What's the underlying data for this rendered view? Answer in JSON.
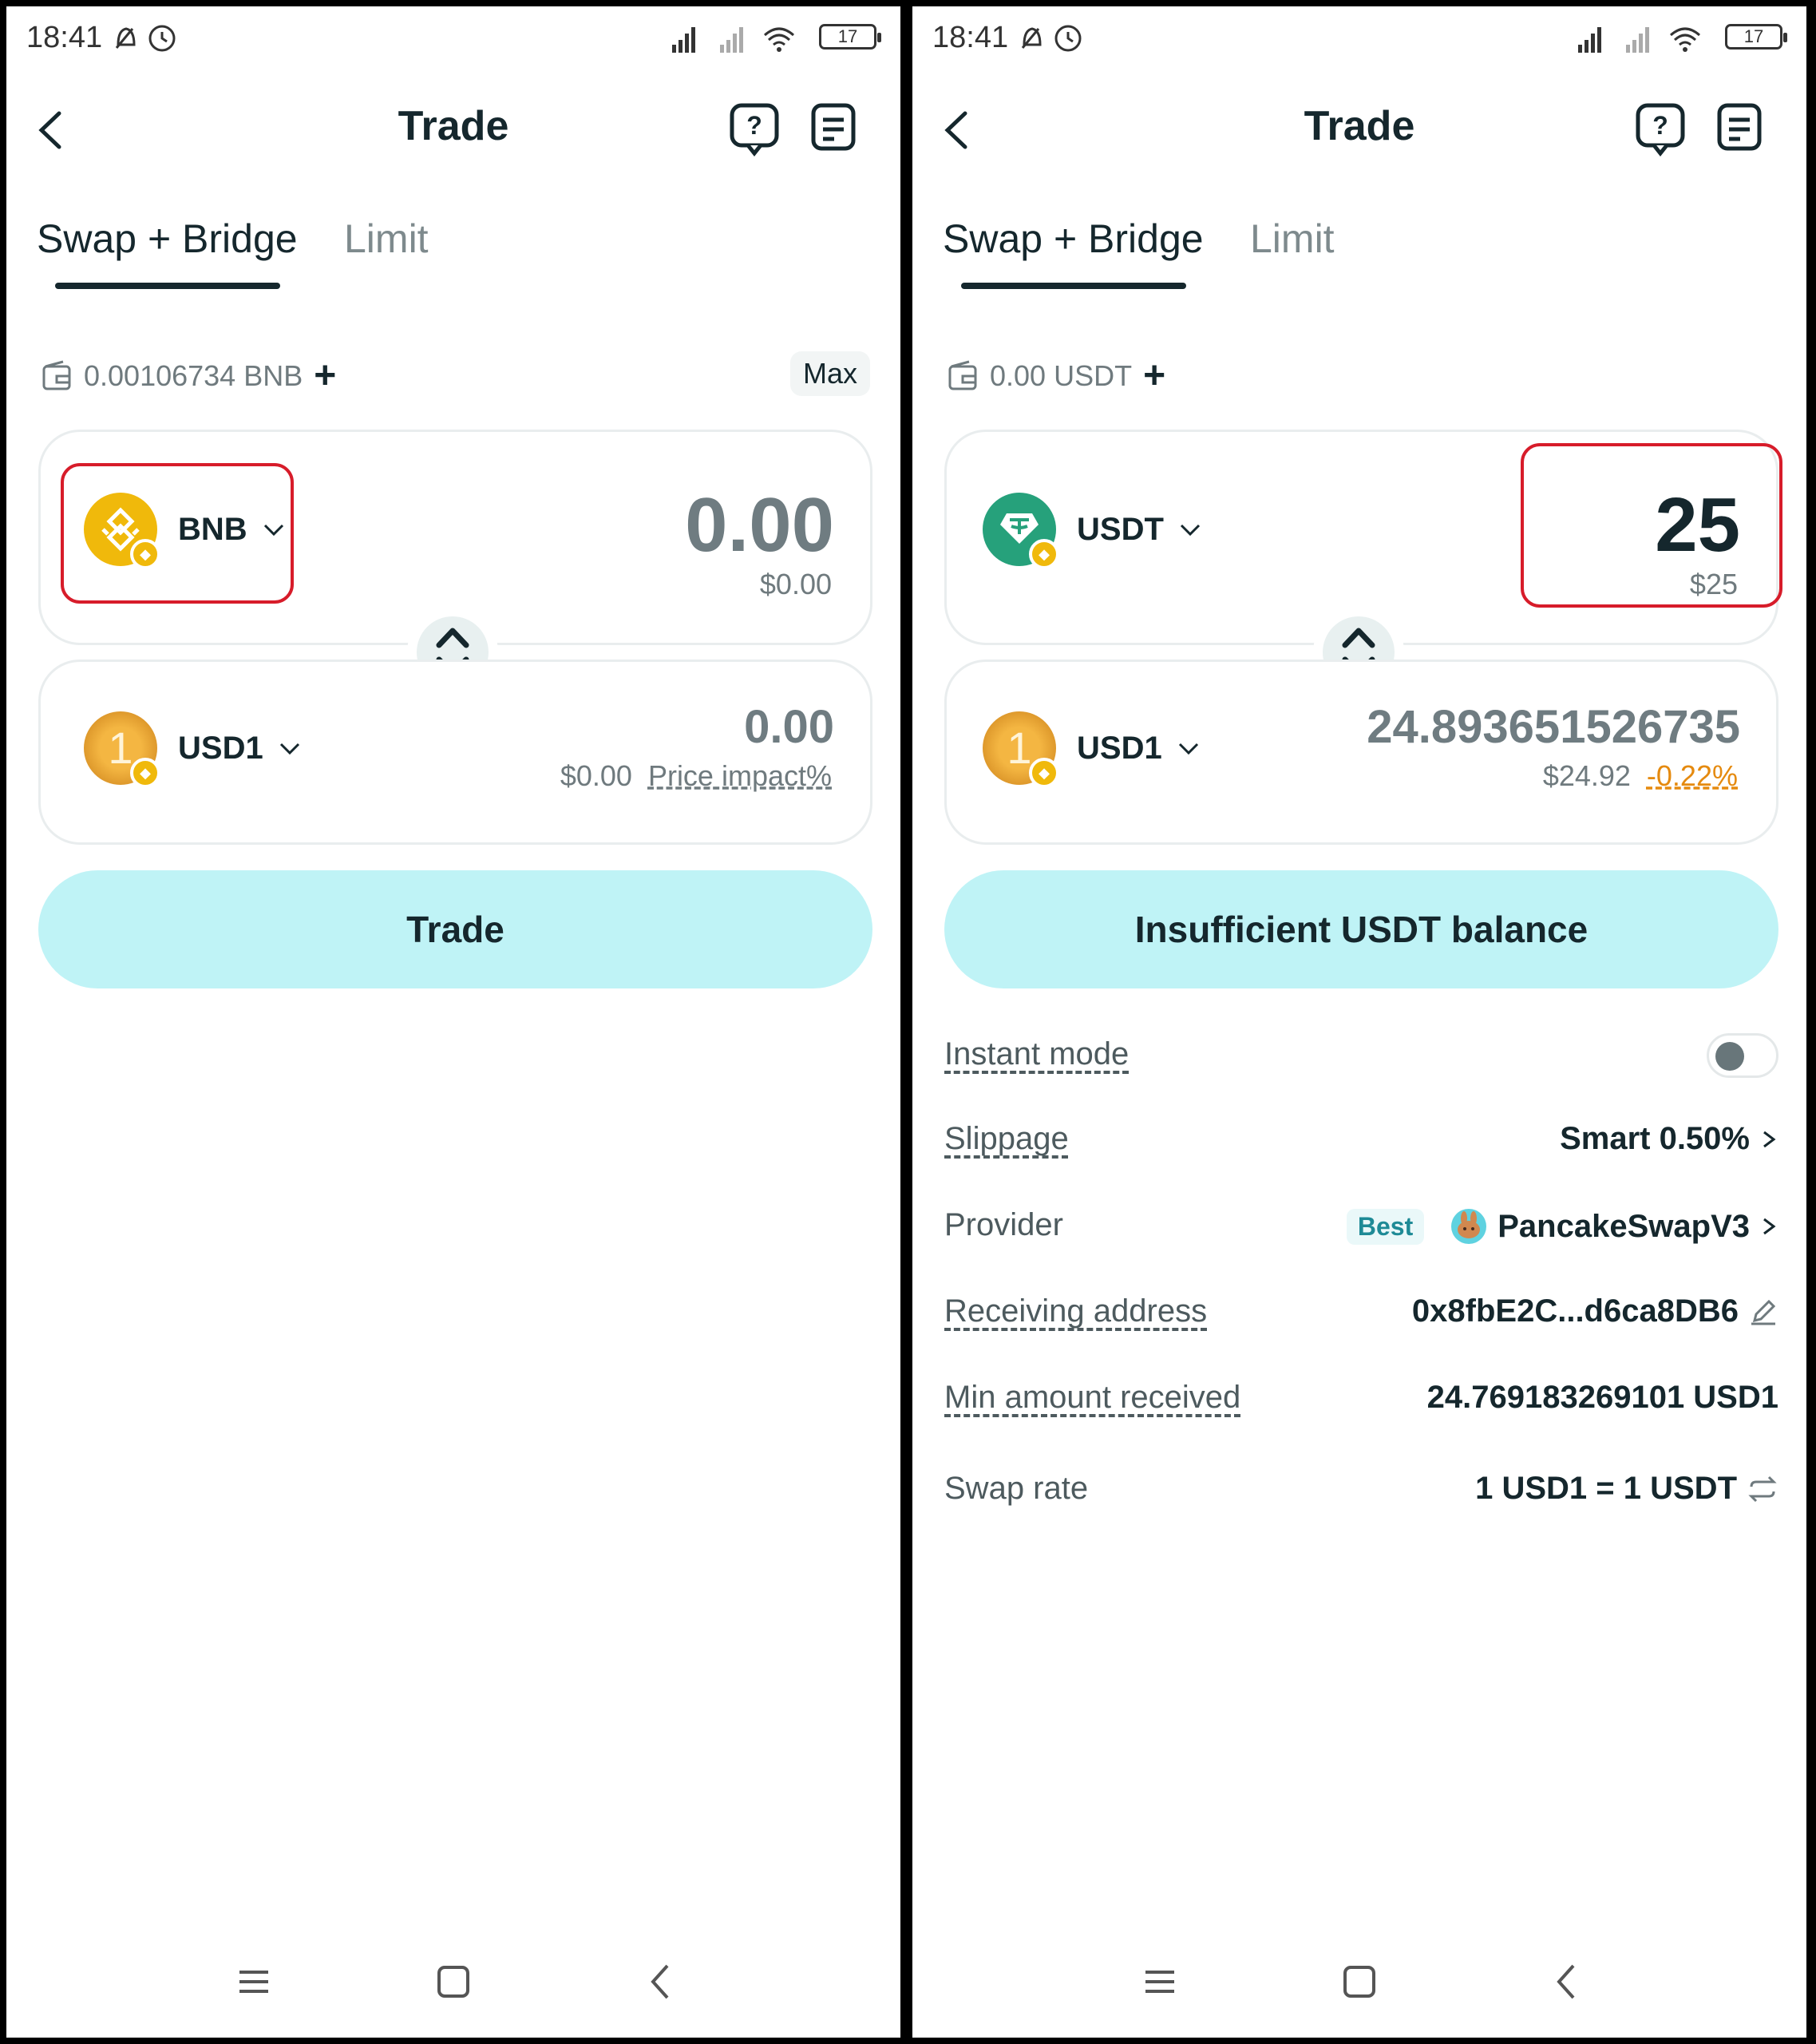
{
  "left": {
    "status": {
      "time": "18:41",
      "battery": "17"
    },
    "header": {
      "title": "Trade"
    },
    "tabs": [
      {
        "label": "Swap + Bridge"
      },
      {
        "label": "Limit"
      }
    ],
    "balance": {
      "text": "0.00106734 BNB",
      "max_label": "Max"
    },
    "from": {
      "token": "BNB",
      "amount": "0.00",
      "usd": "$0.00"
    },
    "to": {
      "token": "USD1",
      "amount": "0.00",
      "usd": "$0.00",
      "impact": "Price impact%"
    },
    "action": {
      "label": "Trade"
    }
  },
  "right": {
    "status": {
      "time": "18:41",
      "battery": "17"
    },
    "header": {
      "title": "Trade"
    },
    "tabs": [
      {
        "label": "Swap + Bridge"
      },
      {
        "label": "Limit"
      }
    ],
    "balance": {
      "text": "0.00 USDT"
    },
    "from": {
      "token": "USDT",
      "amount": "25",
      "usd": "$25"
    },
    "to": {
      "token": "USD1",
      "amount": "24.893651526735",
      "usd": "$24.92",
      "impact": "-0.22%"
    },
    "action": {
      "label": "Insufficient USDT balance"
    },
    "details": {
      "instant_mode": {
        "label": "Instant mode",
        "enabled": false
      },
      "slippage": {
        "label": "Slippage",
        "value": "Smart 0.50%"
      },
      "provider": {
        "label": "Provider",
        "badge": "Best",
        "value": "PancakeSwapV3"
      },
      "receiving": {
        "label": "Receiving address",
        "value": "0x8fbE2C...d6ca8DB6"
      },
      "min_amount": {
        "label": "Min amount received",
        "value": "24.769183269101 USD1"
      },
      "swap_rate": {
        "label": "Swap rate",
        "value": "1 USD1 = 1 USDT"
      }
    }
  },
  "colors": {
    "accent_button": "#bff3f6",
    "highlight": "#d71c2a",
    "bnb": "#f0b90b",
    "usdt": "#26a17b",
    "usd1": "#e2a02a",
    "negative_impact": "#e58a0f"
  },
  "icons": [
    "back-icon",
    "help-icon",
    "history-icon",
    "wallet-icon",
    "plus-icon",
    "chevron-down-icon",
    "swap-direction-icon",
    "chevron-right-icon",
    "edit-icon",
    "refresh-icon",
    "menu-icon",
    "home-icon",
    "nav-back-icon"
  ]
}
